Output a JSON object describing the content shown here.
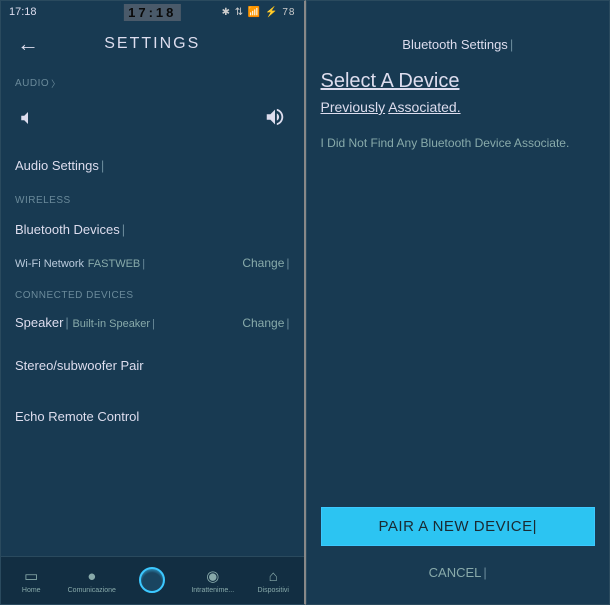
{
  "status": {
    "timeLeft": "17:18",
    "clock": "17:18",
    "rightIcons": "✱ ⇅ 📶 ⚡ 78"
  },
  "left": {
    "title": "SETTINGS",
    "sections": {
      "audio": "AUDIO",
      "audioSettings": "Audio Settings",
      "wireless": "WIRELESS",
      "bluetoothDevices": "Bluetooth Devices",
      "wifiLabel": "Wi-Fi Network",
      "wifiValue": "FASTWEB",
      "connected": "CONNECTED DEVICES",
      "speaker": "Speaker",
      "speakerValue": "Built-in Speaker",
      "stereo": "Stereo/subwoofer Pair",
      "remote": "Echo Remote Control",
      "change": "Change"
    },
    "tabs": [
      "Home",
      "Comunicazione",
      "",
      "Intrattenime...",
      "Dispositivi"
    ]
  },
  "right": {
    "header": "Bluetooth Settings",
    "title": "Select A Device",
    "prev1": "Previously",
    "prev2": "Associated.",
    "msg": "I Did Not Find Any Bluetooth Device Associate.",
    "pair": "PAIR A NEW DEVICE",
    "cancel": "CANCEL"
  }
}
